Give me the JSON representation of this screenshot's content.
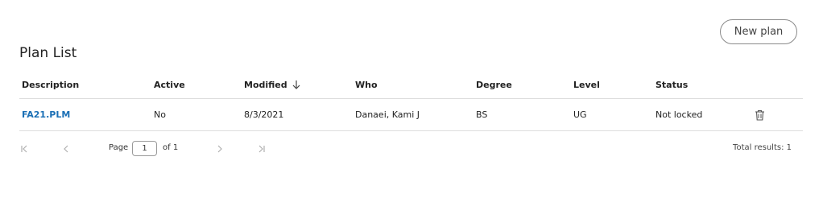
{
  "header": {
    "title": "Plan List",
    "new_plan_label": "New plan"
  },
  "table": {
    "columns": {
      "description": "Description",
      "active": "Active",
      "modified": "Modified",
      "who": "Who",
      "degree": "Degree",
      "level": "Level",
      "status": "Status"
    },
    "sort": {
      "column": "modified",
      "direction": "descending",
      "icon": "arrow-down-icon"
    },
    "rows": [
      {
        "description": "FA21.PLM",
        "active": "No",
        "modified": "8/3/2021",
        "who": "Danaei, Kami J",
        "degree": "BS",
        "level": "UG",
        "status": "Not locked",
        "action_icon": "trash-icon"
      }
    ]
  },
  "pagination": {
    "page_label": "Page",
    "current_page": "1",
    "of_label": "of 1",
    "total_results": "Total results: 1",
    "icons": [
      "first-page-icon",
      "previous-page-icon",
      "next-page-icon",
      "last-page-icon"
    ]
  },
  "colors": {
    "link": "#1a6fb5",
    "divider": "#dddddd",
    "button_border": "#8a8a8a",
    "icon_disabled": "#b0b0b0"
  }
}
